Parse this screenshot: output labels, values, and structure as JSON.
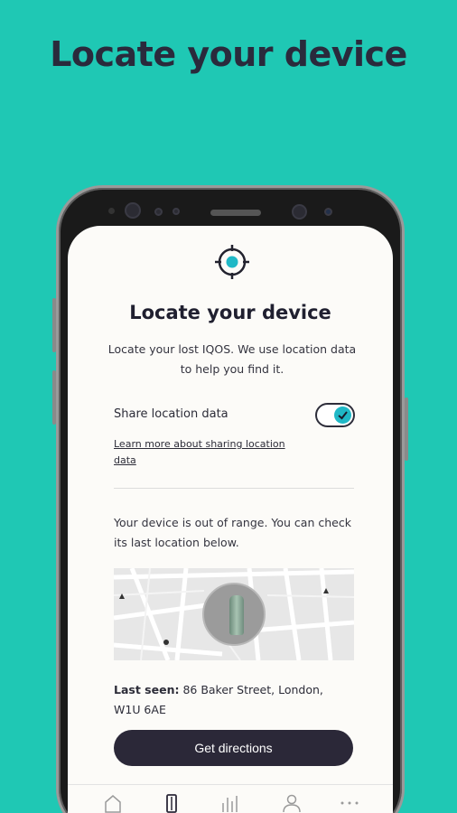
{
  "promo": {
    "heading": "Locate your device"
  },
  "screen": {
    "title": "Locate your device",
    "description": "Locate your lost IQOS. We use location data to help you find it.",
    "share_label": "Share location data",
    "share_enabled": true,
    "learn_more_link": "Learn more about sharing location data",
    "range_text": "Your device is out of range. You can check its last location below.",
    "last_seen_label": "Last seen:",
    "last_seen_address": " 86 Baker Street, London, W1U 6AE",
    "directions_button": "Get directions"
  },
  "bottom_nav": {
    "items": [
      {
        "icon": "home-icon"
      },
      {
        "icon": "device-icon",
        "active": true
      },
      {
        "icon": "chart-icon"
      },
      {
        "icon": "profile-icon"
      },
      {
        "icon": "more-icon"
      }
    ]
  },
  "colors": {
    "background": "#1fc8b4",
    "accent": "#1fb8c6",
    "button": "#2b2838",
    "text_dark": "#202030"
  }
}
